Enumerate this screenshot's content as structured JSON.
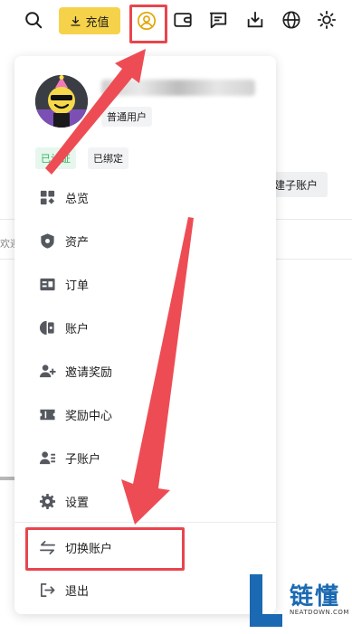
{
  "toolbar": {
    "recharge_label": "充值",
    "icons": [
      "search-icon",
      "download-icon",
      "user-icon",
      "wallet-icon",
      "message-icon",
      "download-box-icon",
      "globe-icon",
      "theme-sun-icon"
    ]
  },
  "background_page": {
    "subaccount_button": "建子账户",
    "welcome_fragment": "欢迎"
  },
  "user_menu": {
    "user_type": "普通用户",
    "badges": {
      "verified": "已认证",
      "bound": "已绑定"
    },
    "items": [
      {
        "label": "总览",
        "icon": "overview-icon"
      },
      {
        "label": "资产",
        "icon": "assets-icon"
      },
      {
        "label": "订单",
        "icon": "orders-icon"
      },
      {
        "label": "账户",
        "icon": "account-icon"
      },
      {
        "label": "邀请奖励",
        "icon": "invite-reward-icon"
      },
      {
        "label": "奖励中心",
        "icon": "reward-center-icon"
      },
      {
        "label": "子账户",
        "icon": "subaccount-icon"
      },
      {
        "label": "设置",
        "icon": "settings-icon"
      },
      {
        "label": "切换账户",
        "icon": "switch-account-icon"
      },
      {
        "label": "退出",
        "icon": "logout-icon"
      }
    ]
  },
  "watermark": {
    "text": "链懂",
    "subtext": "NEATDOWN.COM"
  },
  "colors": {
    "accent_yellow": "#f6d24a",
    "annotation_red": "#e8454d",
    "verified_green": "#2db55d",
    "watermark_blue": "#1a69b2"
  }
}
